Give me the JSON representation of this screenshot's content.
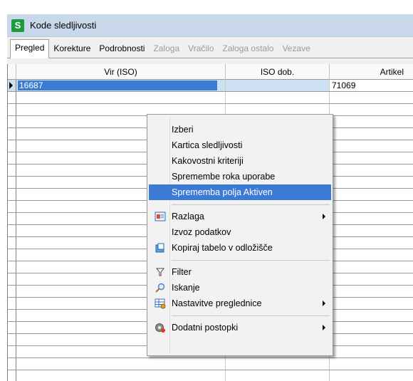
{
  "window": {
    "title": "Kode sledljivosti",
    "icon_letter": "S"
  },
  "tabs": [
    {
      "label": "Pregled",
      "state": "active"
    },
    {
      "label": "Korekture",
      "state": "normal"
    },
    {
      "label": "Podrobnosti",
      "state": "normal"
    },
    {
      "label": "Zaloga",
      "state": "disabled"
    },
    {
      "label": "Vračilo",
      "state": "disabled"
    },
    {
      "label": "Zaloga ostalo",
      "state": "disabled"
    },
    {
      "label": "Vezave",
      "state": "disabled"
    }
  ],
  "grid": {
    "columns": [
      "Vir (ISO)",
      "ISO dob.",
      "Artikel"
    ],
    "rows": [
      {
        "vir": "16687",
        "iso_dob": "",
        "artikel": "71069",
        "selected": true
      }
    ]
  },
  "context_menu": {
    "items": [
      {
        "label": "Izberi",
        "icon": "",
        "highlight": false,
        "submenu": false
      },
      {
        "label": "Kartica sledljivosti",
        "icon": "",
        "highlight": false,
        "submenu": false
      },
      {
        "label": "Kakovostni kriteriji",
        "icon": "",
        "highlight": false,
        "submenu": false
      },
      {
        "label": "Spremembe roka uporabe",
        "icon": "",
        "highlight": false,
        "submenu": false
      },
      {
        "label": "Sprememba polja Aktiven",
        "icon": "",
        "highlight": true,
        "submenu": false
      },
      {
        "label": "Razlaga",
        "icon": "explain-icon",
        "highlight": false,
        "submenu": true
      },
      {
        "label": "Izvoz podatkov",
        "icon": "",
        "highlight": false,
        "submenu": false
      },
      {
        "label": "Kopiraj tabelo v odložišče",
        "icon": "clipboard-icon",
        "highlight": false,
        "submenu": false
      },
      {
        "label": "Filter",
        "icon": "filter-icon",
        "highlight": false,
        "submenu": false
      },
      {
        "label": "Iskanje",
        "icon": "search-icon",
        "highlight": false,
        "submenu": false
      },
      {
        "label": "Nastavitve preglednice",
        "icon": "grid-settings-icon",
        "highlight": false,
        "submenu": true
      },
      {
        "label": "Dodatni postopki",
        "icon": "gear-icon",
        "highlight": false,
        "submenu": true
      }
    ]
  },
  "colors": {
    "highlight": "#3b7bd5",
    "selected_cell": "#3b7bd5",
    "selected_row": "#cde0f2",
    "brand": "#1e9a3f"
  }
}
